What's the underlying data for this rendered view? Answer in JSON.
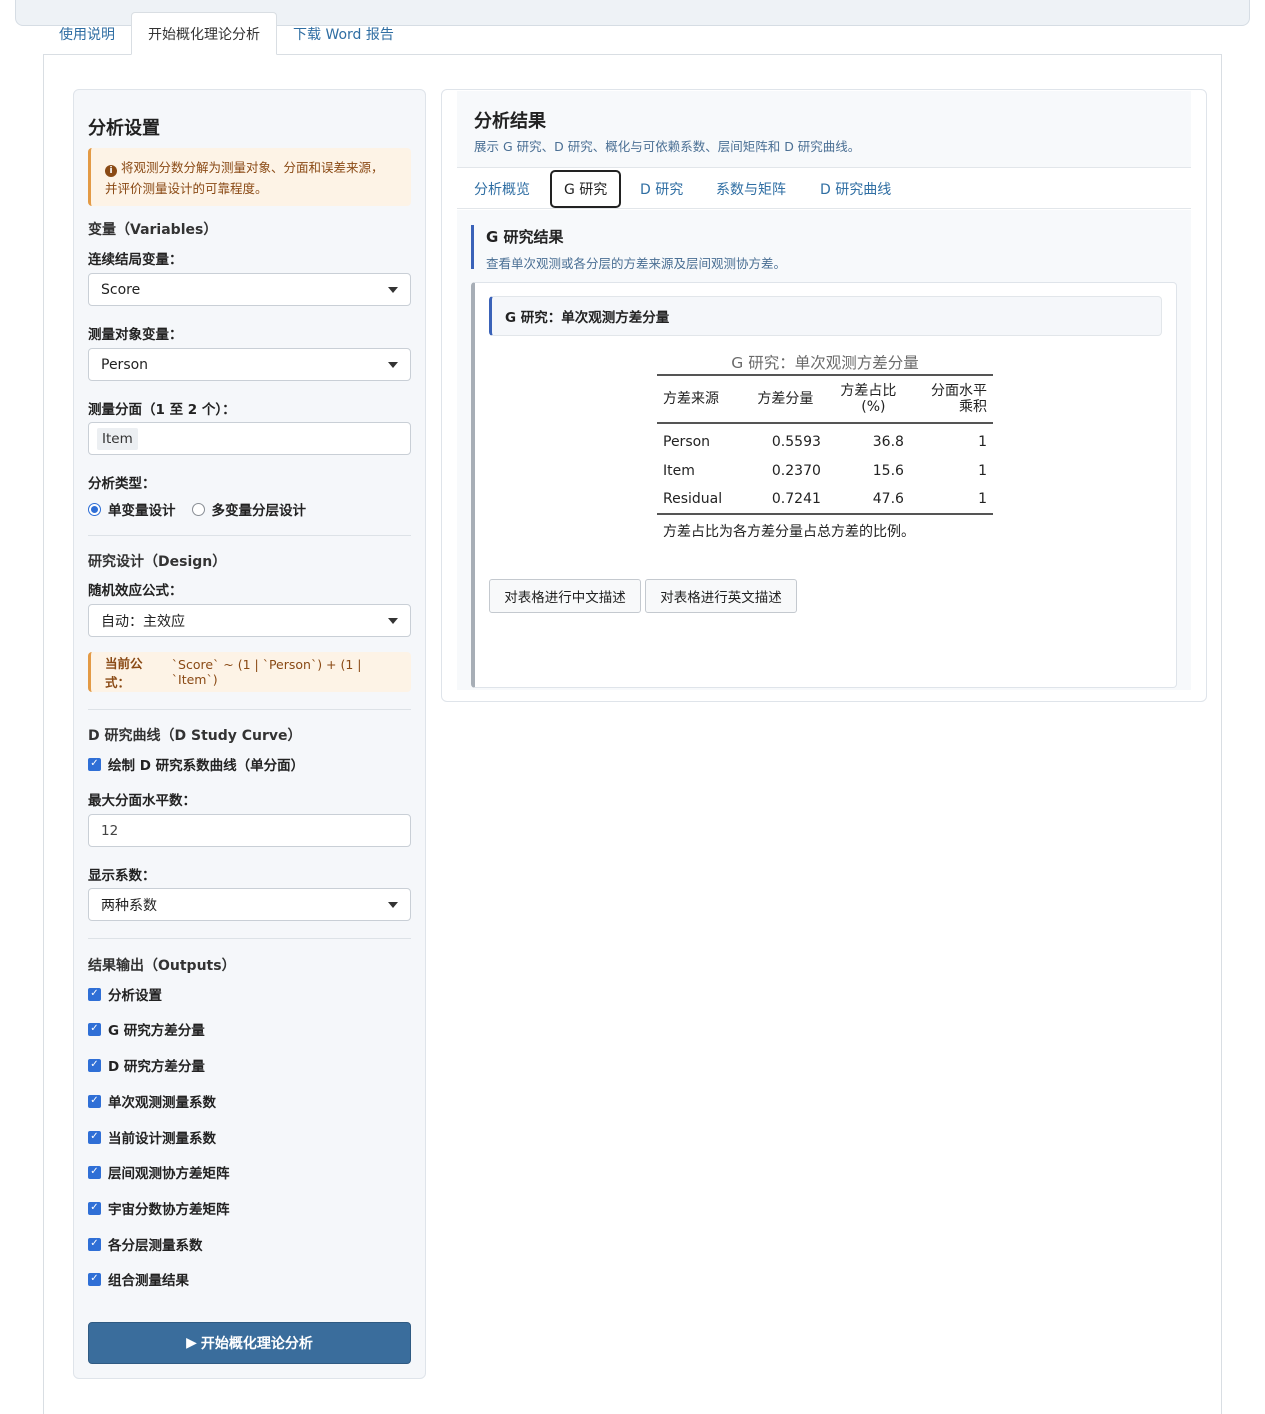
{
  "nav_tabs": [
    {
      "label": "使用说明"
    },
    {
      "label": "开始概化理论分析",
      "active": true
    },
    {
      "label": "下载 Word 报告"
    }
  ],
  "sidebar": {
    "title": "分析设置",
    "intro_alert_line1": "将观测分数分解为测量对象、分面和误差来源，",
    "intro_alert_line2": "并评价测量设计的可靠程度。",
    "variables": {
      "section_title": "变量（Variables）",
      "outcome_label": "连续结局变量：",
      "outcome_value": "Score",
      "object_label": "测量对象变量：",
      "object_value": "Person",
      "facets_label": "测量分面（1 至 2 个）：",
      "facets_value": "Item",
      "analysis_type_label": "分析类型：",
      "analysis_types": [
        {
          "label": "单变量设计",
          "selected": true
        },
        {
          "label": "多变量分层设计",
          "selected": false
        }
      ]
    },
    "design": {
      "section_title": "研究设计（Design）",
      "formula_label": "随机效应公式：",
      "formula_value": "自动：主效应",
      "current_formula_label": "当前公式：",
      "current_formula": "`Score` ~ (1 | `Person`) + (1 | `Item`)"
    },
    "dstudy": {
      "section_title": "D 研究曲线（D Study Curve）",
      "plot_checkbox_label": "绘制 D 研究系数曲线（单分面）",
      "plot_checked": true,
      "max_levels_label": "最大分面水平数：",
      "max_levels_value": "12",
      "coef_label": "显示系数：",
      "coef_value": "两种系数"
    },
    "outputs": {
      "section_title": "结果输出（Outputs）",
      "items": [
        {
          "label": "分析设置",
          "checked": true
        },
        {
          "label": "G 研究方差分量",
          "checked": true
        },
        {
          "label": "D 研究方差分量",
          "checked": true
        },
        {
          "label": "单次观测测量系数",
          "checked": true
        },
        {
          "label": "当前设计测量系数",
          "checked": true
        },
        {
          "label": "层间观测协方差矩阵",
          "checked": true
        },
        {
          "label": "宇宙分数协方差矩阵",
          "checked": true
        },
        {
          "label": "各分层测量系数",
          "checked": true
        },
        {
          "label": "组合测量结果",
          "checked": true
        }
      ]
    },
    "run_button": "开始概化理论分析"
  },
  "main": {
    "title": "分析结果",
    "subtitle": "展示 G 研究、D 研究、概化与可依赖系数、层间矩阵和 D 研究曲线。",
    "tabs": [
      {
        "label": "分析概览"
      },
      {
        "label": "G 研究",
        "active": true
      },
      {
        "label": "D 研究"
      },
      {
        "label": "系数与矩阵"
      },
      {
        "label": "D 研究曲线"
      }
    ],
    "gstudy": {
      "title": "G 研究结果",
      "subtitle": "查看单次观测或各分层的方差来源及层间观测协方差。",
      "card_title": "G 研究：单次观测方差分量",
      "table_caption": "G 研究：单次观测方差分量",
      "table_headers": {
        "source": "方差来源",
        "var_comp": "方差分量",
        "pct_line1": "方差占比",
        "pct_line2": "(%)",
        "levels_line1": "分面水平",
        "levels_line2": "乘积"
      },
      "rows": [
        {
          "source": "Person",
          "var": "0.5593",
          "pct": "36.8",
          "levels": "1"
        },
        {
          "source": "Item",
          "var": "0.2370",
          "pct": "15.6",
          "levels": "1"
        },
        {
          "source": "Residual",
          "var": "0.7241",
          "pct": "47.6",
          "levels": "1"
        }
      ],
      "table_note": "方差占比为各方差分量占总方差的比例。",
      "btn_cn": "对表格进行中文描述",
      "btn_en": "对表格进行英文描述"
    }
  },
  "colors": {
    "accent": "#2f6ea3",
    "primary_button": "#3a6d9c",
    "alert_bg": "#fdf3e6",
    "alert_border": "#e39a45",
    "checkbox": "#2f6fd6"
  }
}
